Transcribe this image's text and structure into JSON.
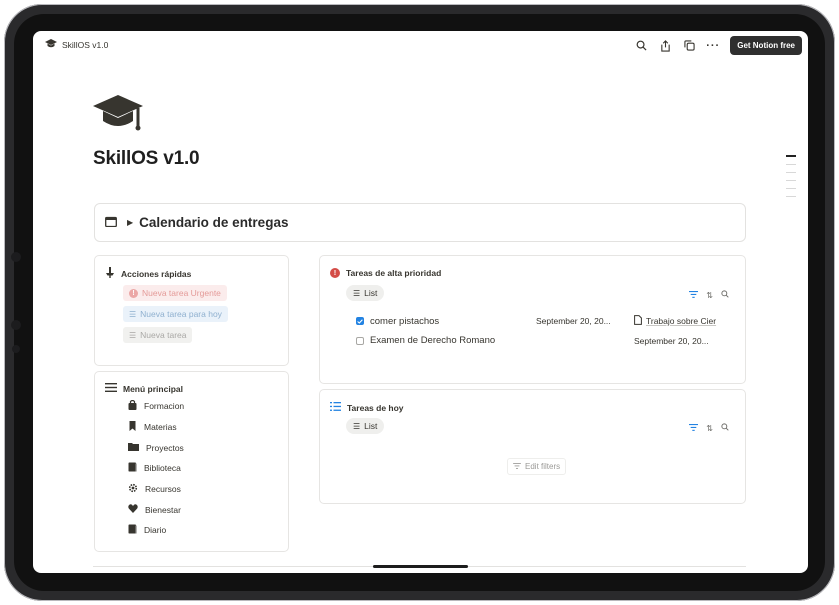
{
  "topbar": {
    "breadcrumb": "SkillOS v1.0",
    "get_notion": "Get Notion free",
    "icons": [
      "search-icon",
      "share-icon",
      "duplicate-icon",
      "more-icon"
    ]
  },
  "page": {
    "icon": "graduation-cap-icon",
    "title": "SkillOS v1.0"
  },
  "toggle": {
    "icon": "calendar-icon",
    "label": "Calendario de entregas"
  },
  "quick_actions": {
    "title": "Acciones rápidas",
    "buttons": [
      {
        "label": "Nueva tarea Urgente",
        "color": "#f5dcdc",
        "text_color": "#e49a98"
      },
      {
        "label": "Nueva tarea para hoy",
        "color": "#e4eef8",
        "text_color": "#8fb0cf"
      },
      {
        "label": "Nueva tarea",
        "color": "#efefed",
        "text_color": "#a9a8a5"
      }
    ]
  },
  "main_menu": {
    "title": "Menú principal",
    "items": [
      {
        "label": "Formacion",
        "icon": "bag-icon"
      },
      {
        "label": "Materias",
        "icon": "bookmark-icon"
      },
      {
        "label": "Proyectos",
        "icon": "folder-icon"
      },
      {
        "label": "Biblioteca",
        "icon": "book-icon"
      },
      {
        "label": "Recursos",
        "icon": "gear-icon"
      },
      {
        "label": "Bienestar",
        "icon": "heart-icon"
      },
      {
        "label": "Diario",
        "icon": "journal-icon"
      }
    ]
  },
  "high_priority": {
    "title": "Tareas de alta prioridad",
    "view": "List",
    "tasks": [
      {
        "name": "comer pistachos",
        "date": "September 20, 20...",
        "project": "Trabajo sobre Cier",
        "checked": true
      },
      {
        "name": "Examen de Derecho Romano",
        "date": "September 20, 20...",
        "project": "",
        "checked": false
      }
    ]
  },
  "today": {
    "title": "Tareas de hoy",
    "view": "List",
    "edit_filters": "Edit filters"
  }
}
